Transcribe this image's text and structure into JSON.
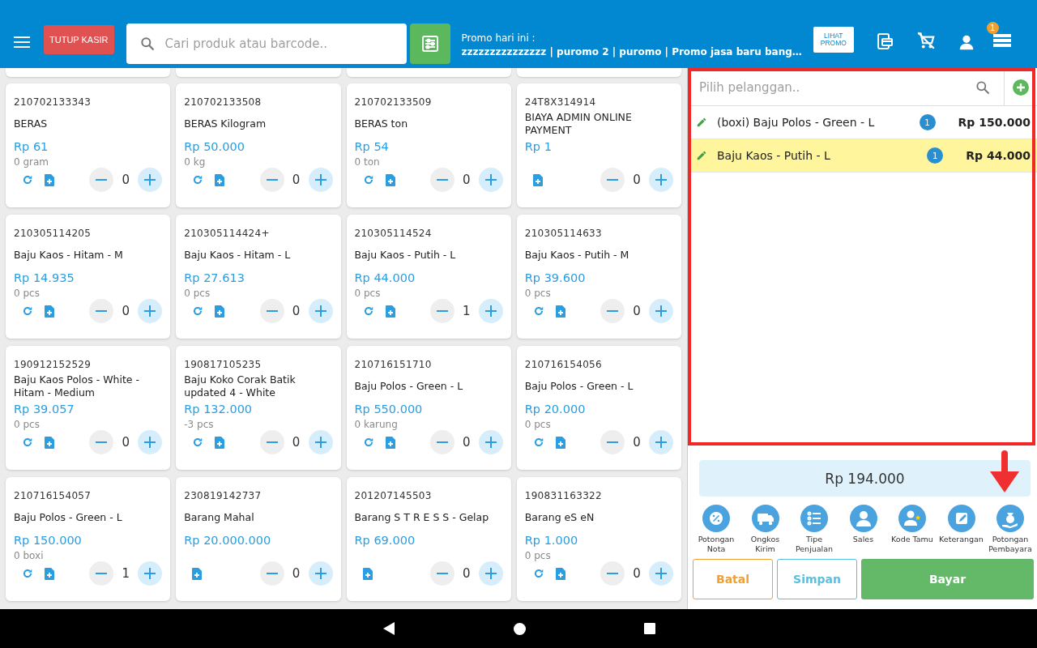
{
  "topbar": {
    "close_button": "TUTUP KASIR",
    "search": {
      "placeholder": "Cari produk atau barcode.."
    },
    "promo_label": "Promo hari ini :",
    "promo_text": "zzzzzzzzzzzzzzz | puromo 2 | puromo | Promo jasa baru bang…",
    "promo_button": "LIHAT PROMO",
    "menu_badge": "1"
  },
  "products": [
    {
      "code": "210702133343",
      "name": "BERAS",
      "price": "Rp 61",
      "stock": "0 gram",
      "has_refresh": true,
      "qty": "0"
    },
    {
      "code": "210702133508",
      "name": "BERAS Kilogram",
      "price": "Rp 50.000",
      "stock": "0 kg",
      "has_refresh": true,
      "qty": "0"
    },
    {
      "code": "210702133509",
      "name": "BERAS ton",
      "price": "Rp 54",
      "stock": "0 ton",
      "has_refresh": true,
      "qty": "0"
    },
    {
      "code": "24T8X314914",
      "name": "BIAYA ADMIN ONLINE PAYMENT",
      "price": "Rp 1",
      "has_refresh": false,
      "qty": "0"
    },
    {
      "code": "210305114205",
      "name": "Baju Kaos - Hitam - M",
      "price": "Rp 14.935",
      "stock": "0 pcs",
      "has_refresh": true,
      "qty": "0"
    },
    {
      "code": "210305114424+",
      "name": "Baju Kaos - Hitam - L",
      "price": "Rp 27.613",
      "stock": "0 pcs",
      "has_refresh": true,
      "qty": "0"
    },
    {
      "code": "210305114524",
      "name": "Baju Kaos - Putih - L",
      "price": "Rp 44.000",
      "stock": "0 pcs",
      "has_refresh": true,
      "qty": "1"
    },
    {
      "code": "210305114633",
      "name": "Baju Kaos - Putih - M",
      "price": "Rp 39.600",
      "stock": "0 pcs",
      "has_refresh": true,
      "qty": "0"
    },
    {
      "code": "190912152529",
      "name": "Baju Kaos Polos - White - Hitam - Medium",
      "price": "Rp 39.057",
      "stock": "0 pcs",
      "has_refresh": true,
      "qty": "0"
    },
    {
      "code": "190817105235",
      "name": "Baju Koko Corak Batik updated 4 - White",
      "price": "Rp 132.000",
      "stock": "-3 pcs",
      "has_refresh": true,
      "qty": "0"
    },
    {
      "code": "210716151710",
      "name": "Baju Polos - Green - L",
      "price": "Rp 550.000",
      "stock": "0 karung",
      "has_refresh": true,
      "qty": "0"
    },
    {
      "code": "210716154056",
      "name": "Baju Polos - Green - L",
      "price": "Rp 20.000",
      "stock": "0 pcs",
      "has_refresh": true,
      "qty": "0"
    },
    {
      "code": "210716154057",
      "name": "Baju Polos - Green - L",
      "price": "Rp 150.000",
      "stock": "0 boxi",
      "has_refresh": true,
      "qty": "1"
    },
    {
      "code": "230819142737",
      "name": "Barang Mahal",
      "price": "Rp 20.000.000",
      "has_refresh": false,
      "qty": "0"
    },
    {
      "code": "201207145503",
      "name": "Barang S T R E S S - Gelap",
      "price": "Rp 69.000",
      "has_refresh": false,
      "qty": "0"
    },
    {
      "code": "190831163322",
      "name": "Barang eS eN",
      "price": "Rp 1.000",
      "stock": "0 pcs",
      "has_refresh": true,
      "qty": "0"
    }
  ],
  "cart": {
    "customer": {
      "placeholder": "Pilih pelanggan.."
    },
    "items": [
      {
        "name": "(boxi) Baju Polos - Green - L",
        "qty": "1",
        "price": "Rp 150.000",
        "selected": false
      },
      {
        "name": "Baju Kaos - Putih - L",
        "qty": "1",
        "price": "Rp 44.000",
        "selected": true
      }
    ],
    "total": "Rp 194.000",
    "actions": [
      {
        "kind": "percent",
        "label": "Potongan Nota"
      },
      {
        "kind": "truck",
        "label": "Ongkos Kirim"
      },
      {
        "kind": "list",
        "label": "Tipe Penjualan"
      },
      {
        "kind": "person",
        "label": "Sales"
      },
      {
        "kind": "guest",
        "label": "Kode Tamu"
      },
      {
        "kind": "note",
        "label": "Keterangan"
      },
      {
        "kind": "money",
        "label": "Potongan Pembayara"
      }
    ],
    "buttons": {
      "cancel": "Batal",
      "save": "Simpan",
      "pay": "Bayar"
    }
  }
}
